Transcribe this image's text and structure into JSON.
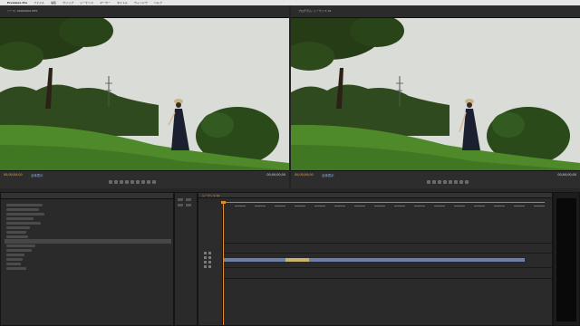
{
  "menubar": {
    "app": "Premiere Pro",
    "items": [
      "ファイル",
      "編集",
      "クリップ",
      "シーケンス",
      "マーカー",
      "タイトル",
      "ウィンドウ",
      "ヘルプ"
    ],
    "clock": ""
  },
  "source_monitor": {
    "title": "ソース: 00000000.MTS",
    "timecode": "00;00;00;00",
    "fit": "全体表示",
    "duration": "00;00;00;00"
  },
  "program_monitor": {
    "title": "プログラム: シーケンス 01",
    "timecode": "00;00;00;00",
    "fit": "全体表示",
    "duration": "00;00;00;00"
  },
  "project_panel": {
    "items": [
      "",
      "",
      "",
      "",
      "",
      "",
      "",
      "",
      "",
      "",
      "",
      "",
      "",
      "",
      "",
      "",
      "",
      "",
      "",
      ""
    ]
  },
  "timeline": {
    "tab": "シーケンス 01",
    "ruler_labels": [
      "",
      "",
      "",
      "",
      "",
      "",
      "",
      "",
      "",
      "",
      "",
      "",
      "",
      "",
      "",
      "",
      "",
      "",
      "",
      ""
    ],
    "video_clip": {
      "label": ""
    },
    "audio_clip": {
      "label": ""
    }
  },
  "colors": {
    "timecode": "#e6b33c",
    "fit_link": "#8fb6e8",
    "clip_video": "#6b7fa8",
    "clip_audio": "#5a7bb0",
    "playhead": "#e08a2e",
    "sky": "#d9dcd8",
    "grass": "#4f8a2a"
  },
  "icons": [
    "play-icon",
    "stop-icon",
    "step-back-icon",
    "step-forward-icon",
    "marker-icon",
    "in-point-icon",
    "out-point-icon",
    "insert-icon",
    "overwrite-icon",
    "export-frame-icon",
    "settings-icon"
  ]
}
